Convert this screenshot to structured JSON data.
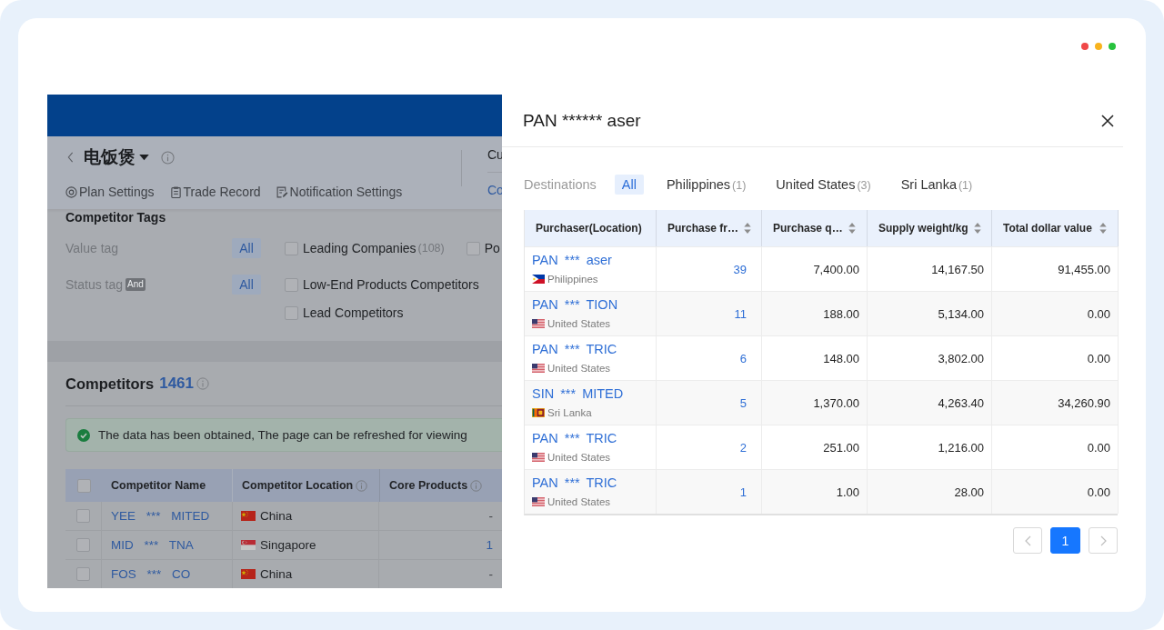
{
  "page": {
    "header": {
      "title": "电饭煲",
      "toolbar": [
        {
          "label": "Plan Settings"
        },
        {
          "label": "Trade Record"
        },
        {
          "label": "Notification Settings"
        }
      ],
      "side": {
        "heading": "Cu",
        "link": "Co"
      }
    },
    "tags": {
      "title": "Competitor Tags",
      "rows": [
        {
          "label": "Value tag",
          "all": {
            "label": "All",
            "selected": true
          },
          "options": [
            {
              "label": "Leading Companies",
              "count": "(108)",
              "checked": false
            },
            {
              "label": "Po",
              "checked": false
            }
          ]
        },
        {
          "label": "Status tag",
          "badge": "And",
          "all": {
            "label": "All",
            "selected": true
          },
          "options": [
            {
              "label": "Low-End Products Competitors",
              "checked": false
            },
            {
              "label": "Lead Competitors",
              "checked": false
            }
          ]
        }
      ]
    },
    "competitors": {
      "title": "Competitors",
      "count": "1461",
      "alert": {
        "text": "The data has been obtained, The page can be refreshed for viewing"
      },
      "table": {
        "select_all": {
          "checked": false
        },
        "columns": [
          {
            "label": "Competitor Name",
            "info": false
          },
          {
            "label": "Competitor Location",
            "info": true
          },
          {
            "label": "Core Products",
            "info": true
          }
        ],
        "rows": [
          {
            "checked": false,
            "name": "YEE *** MITED",
            "location": {
              "kind": "cn",
              "name": "China"
            },
            "core_products": {
              "text": "-",
              "link": false
            }
          },
          {
            "checked": false,
            "name": "MID *** TNA",
            "location": {
              "kind": "sg",
              "name": "Singapore"
            },
            "core_products": {
              "text": "1",
              "link": true
            }
          },
          {
            "checked": false,
            "name": "FOS *** CO",
            "location": {
              "kind": "cn",
              "name": "China"
            },
            "core_products": {
              "text": "-",
              "link": false
            }
          }
        ]
      }
    }
  },
  "drawer": {
    "title": "PAN ****** aser",
    "filter": {
      "label": "Destinations",
      "options": [
        {
          "label": "All",
          "selected": true
        },
        {
          "label": "Philippines",
          "count": "(1)",
          "selected": false
        },
        {
          "label": "United States",
          "count": "(3)",
          "selected": false
        },
        {
          "label": "Sri Lanka",
          "count": "(1)",
          "selected": false
        }
      ]
    },
    "table": {
      "columns": [
        {
          "label": "Purchaser(Location)",
          "sortable": false
        },
        {
          "label": "Purchase fr…",
          "sortable": true
        },
        {
          "label": "Purchase q…",
          "sortable": true
        },
        {
          "label": "Supply weight/kg",
          "sortable": true
        },
        {
          "label": "Total dollar value",
          "sortable": true
        }
      ],
      "rows": [
        {
          "cells": [
            "PAN *** aser",
            "39",
            "7,400.00",
            "14,167.50",
            "91,455.00"
          ],
          "location": {
            "kind": "ph",
            "name": "Philippines"
          }
        },
        {
          "cells": [
            "PAN *** TION",
            "11",
            "188.00",
            "5,134.00",
            "0.00"
          ],
          "location": {
            "kind": "us",
            "name": "United States"
          }
        },
        {
          "cells": [
            "PAN *** TRIC",
            "6",
            "148.00",
            "3,802.00",
            "0.00"
          ],
          "location": {
            "kind": "us",
            "name": "United States"
          }
        },
        {
          "cells": [
            "SIN *** MITED",
            "5",
            "1,370.00",
            "4,263.40",
            "34,260.90"
          ],
          "location": {
            "kind": "lk",
            "name": "Sri Lanka"
          }
        },
        {
          "cells": [
            "PAN *** TRIC",
            "2",
            "251.00",
            "1,216.00",
            "0.00"
          ],
          "location": {
            "kind": "us",
            "name": "United States"
          }
        },
        {
          "cells": [
            "PAN *** TRIC",
            "1",
            "1.00",
            "28.00",
            "0.00"
          ],
          "location": {
            "kind": "us",
            "name": "United States"
          }
        }
      ]
    },
    "pagination": {
      "prev": {
        "disabled": true
      },
      "next": {
        "disabled": true
      },
      "pages": [
        {
          "label": "1",
          "selected": true
        }
      ]
    }
  }
}
